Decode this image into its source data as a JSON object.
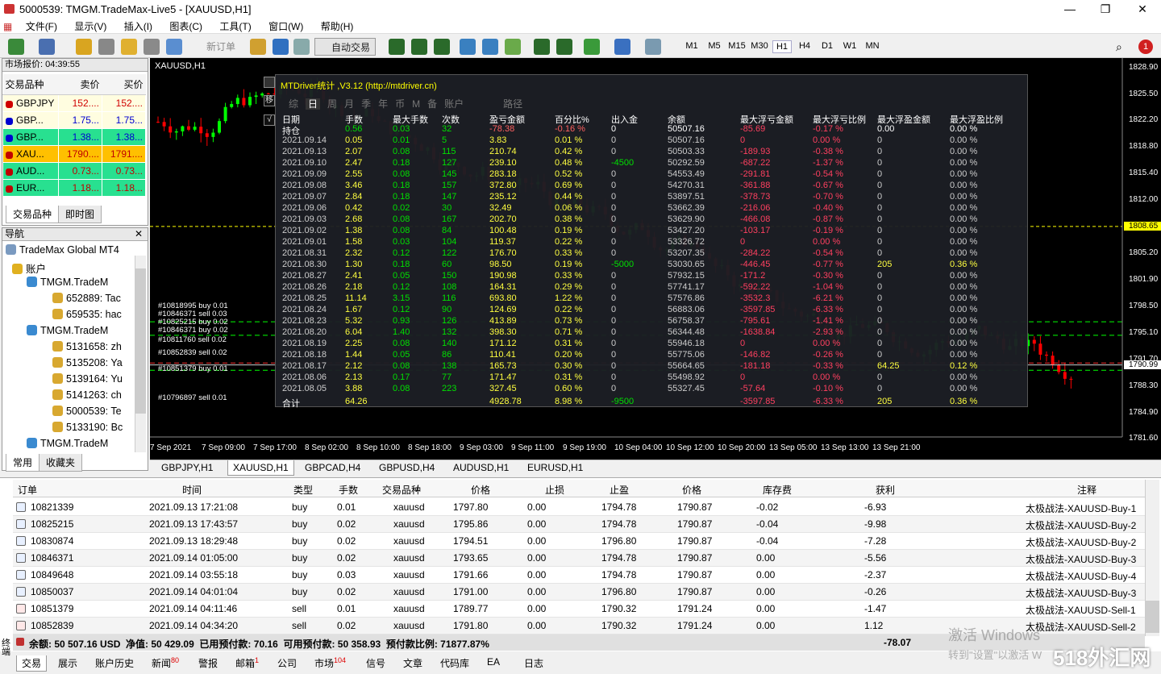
{
  "window": {
    "title": "5000539: TMGM.TradeMax-Live5 - [XAUUSD,H1]"
  },
  "menu": [
    "文件(F)",
    "显示(V)",
    "插入(I)",
    "图表(C)",
    "工具(T)",
    "窗口(W)",
    "帮助(H)"
  ],
  "toolbar": {
    "new_order": "新订单",
    "auto_trade": "自动交易",
    "timeframes": [
      "M1",
      "M5",
      "M15",
      "M30",
      "H1",
      "H4",
      "D1",
      "W1",
      "MN"
    ],
    "active_tf": "H1",
    "notify_count": "1"
  },
  "market_watch": {
    "title": "市场报价: 04:39:55",
    "headers": [
      "交易品种",
      "卖价",
      "买价"
    ],
    "rows": [
      {
        "sym": "GBPJPY",
        "bid": "152....",
        "ask": "152....",
        "bg": "#fffde0",
        "color": "#d00000"
      },
      {
        "sym": "GBP...",
        "bid": "1.75...",
        "ask": "1.75...",
        "bg": "#fffde0",
        "color": "#0000d0"
      },
      {
        "sym": "GBP...",
        "bid": "1.38...",
        "ask": "1.38...",
        "bg": "#28e090",
        "color": "#0000d0"
      },
      {
        "sym": "XAU...",
        "bid": "1790....",
        "ask": "1791....",
        "bg": "#ffc000",
        "color": "#c00000"
      },
      {
        "sym": "AUD...",
        "bid": "0.73...",
        "ask": "0.73...",
        "bg": "#28e090",
        "color": "#c00000"
      },
      {
        "sym": "EUR...",
        "bid": "1.18...",
        "ask": "1.18...",
        "bg": "#28e090",
        "color": "#c00000"
      }
    ],
    "tabs": [
      "交易品种",
      "即时图"
    ]
  },
  "navigator": {
    "title": "导航",
    "items": [
      "TradeMax Global MT4",
      "账户",
      "TMGM.TradeM",
      "652889: Tac",
      "659535: hac",
      "TMGM.TradeM",
      "5131658: zh",
      "5135208: Ya",
      "5139164: Yu",
      "5141263: ch",
      "5000539: Te",
      "5133190: Bc",
      "TMGM.TradeM"
    ],
    "tabs": [
      "常用",
      "收藏夹"
    ]
  },
  "chart": {
    "symbol": "XAUUSD,H1",
    "prices": [
      "1828.90",
      "1825.50",
      "1822.20",
      "1818.80",
      "1815.40",
      "1812.00",
      "1808.65",
      "1805.20",
      "1801.90",
      "1798.50",
      "1795.10",
      "1791.70",
      "1790.99",
      "1788.30",
      "1784.90",
      "1781.60"
    ],
    "times": [
      "7 Sep 2021",
      "7 Sep 09:00",
      "7 Sep 17:00",
      "8 Sep 02:00",
      "8 Sep 10:00",
      "8 Sep 18:00",
      "9 Sep 03:00",
      "9 Sep 11:00",
      "9 Sep 19:00",
      "10 Sep 04:00",
      "10 Sep 12:00",
      "10 Sep 20:00",
      "13 Sep 05:00",
      "13 Sep 13:00",
      "13 Sep 21:00"
    ],
    "orders": [
      "#10818995 buy 0.01",
      "#10846371 sell 0.03",
      "#10825215 buy 0.02",
      "#10846371 buy 0.02",
      "#10811760 sell 0.02",
      "#10852839 sell 0.02",
      "#10851379 buy 0.01",
      "#10796897 sell 0.01"
    ]
  },
  "stat": {
    "title": "MTDriver统计 ,V3.12 (http://mtdriver.cn)",
    "tabs": [
      "综",
      "日",
      "周",
      "月",
      "季",
      "年",
      "币",
      "M",
      "备",
      "账户",
      "路径"
    ],
    "active_tab": "日",
    "side_buttons": [
      "移",
      "√"
    ],
    "headers": [
      "日期",
      "手数",
      "最大手数",
      "次数",
      "盈亏金额",
      "百分比%",
      "出入金",
      "余额",
      "最大浮亏金额",
      "最大浮亏比例",
      "最大浮盈金额",
      "最大浮盈比例"
    ],
    "hold": [
      "持仓",
      "0.56",
      "0.03",
      "32",
      "-78.38",
      "-0.16 %",
      "0",
      "50507.16",
      "-85.69",
      "-0.17 %",
      "0.00",
      "0.00 %"
    ],
    "rows": [
      [
        "2021.09.14",
        "0.05",
        "0.01",
        "5",
        "3.83",
        "0.01 %",
        "0",
        "50507.16",
        "0",
        "0.00 %",
        "0",
        "0.00 %"
      ],
      [
        "2021.09.13",
        "2.07",
        "0.08",
        "115",
        "210.74",
        "0.42 %",
        "0",
        "50503.33",
        "-189.93",
        "-0.38 %",
        "0",
        "0.00 %"
      ],
      [
        "2021.09.10",
        "2.47",
        "0.18",
        "127",
        "239.10",
        "0.48 %",
        "-4500",
        "50292.59",
        "-687.22",
        "-1.37 %",
        "0",
        "0.00 %"
      ],
      [
        "2021.09.09",
        "2.55",
        "0.08",
        "145",
        "283.18",
        "0.52 %",
        "0",
        "54553.49",
        "-291.81",
        "-0.54 %",
        "0",
        "0.00 %"
      ],
      [
        "2021.09.08",
        "3.46",
        "0.18",
        "157",
        "372.80",
        "0.69 %",
        "0",
        "54270.31",
        "-361.88",
        "-0.67 %",
        "0",
        "0.00 %"
      ],
      [
        "2021.09.07",
        "2.84",
        "0.18",
        "147",
        "235.12",
        "0.44 %",
        "0",
        "53897.51",
        "-378.73",
        "-0.70 %",
        "0",
        "0.00 %"
      ],
      [
        "2021.09.06",
        "0.42",
        "0.02",
        "30",
        "32.49",
        "0.06 %",
        "0",
        "53662.39",
        "-216.06",
        "-0.40 %",
        "0",
        "0.00 %"
      ],
      [
        "2021.09.03",
        "2.68",
        "0.08",
        "167",
        "202.70",
        "0.38 %",
        "0",
        "53629.90",
        "-466.08",
        "-0.87 %",
        "0",
        "0.00 %"
      ],
      [
        "2021.09.02",
        "1.38",
        "0.08",
        "84",
        "100.48",
        "0.19 %",
        "0",
        "53427.20",
        "-103.17",
        "-0.19 %",
        "0",
        "0.00 %"
      ],
      [
        "2021.09.01",
        "1.58",
        "0.03",
        "104",
        "119.37",
        "0.22 %",
        "0",
        "53326.72",
        "0",
        "0.00 %",
        "0",
        "0.00 %"
      ],
      [
        "2021.08.31",
        "2.32",
        "0.12",
        "122",
        "176.70",
        "0.33 %",
        "0",
        "53207.35",
        "-284.22",
        "-0.54 %",
        "0",
        "0.00 %"
      ],
      [
        "2021.08.30",
        "1.30",
        "0.18",
        "60",
        "98.50",
        "0.19 %",
        "-5000",
        "53030.65",
        "-446.45",
        "-0.77 %",
        "205",
        "0.36 %"
      ],
      [
        "2021.08.27",
        "2.41",
        "0.05",
        "150",
        "190.98",
        "0.33 %",
        "0",
        "57932.15",
        "-171.2",
        "-0.30 %",
        "0",
        "0.00 %"
      ],
      [
        "2021.08.26",
        "2.18",
        "0.12",
        "108",
        "164.31",
        "0.29 %",
        "0",
        "57741.17",
        "-592.22",
        "-1.04 %",
        "0",
        "0.00 %"
      ],
      [
        "2021.08.25",
        "11.14",
        "3.15",
        "116",
        "693.80",
        "1.22 %",
        "0",
        "57576.86",
        "-3532.3",
        "-6.21 %",
        "0",
        "0.00 %"
      ],
      [
        "2021.08.24",
        "1.67",
        "0.12",
        "90",
        "124.69",
        "0.22 %",
        "0",
        "56883.06",
        "-3597.85",
        "-6.33 %",
        "0",
        "0.00 %"
      ],
      [
        "2021.08.23",
        "5.32",
        "0.93",
        "126",
        "413.89",
        "0.73 %",
        "0",
        "56758.37",
        "-795.61",
        "-1.41 %",
        "0",
        "0.00 %"
      ],
      [
        "2021.08.20",
        "6.04",
        "1.40",
        "132",
        "398.30",
        "0.71 %",
        "0",
        "56344.48",
        "-1638.84",
        "-2.93 %",
        "0",
        "0.00 %"
      ],
      [
        "2021.08.19",
        "2.25",
        "0.08",
        "140",
        "171.12",
        "0.31 %",
        "0",
        "55946.18",
        "0",
        "0.00 %",
        "0",
        "0.00 %"
      ],
      [
        "2021.08.18",
        "1.44",
        "0.05",
        "86",
        "110.41",
        "0.20 %",
        "0",
        "55775.06",
        "-146.82",
        "-0.26 %",
        "0",
        "0.00 %"
      ],
      [
        "2021.08.17",
        "2.12",
        "0.08",
        "138",
        "165.73",
        "0.30 %",
        "0",
        "55664.65",
        "-181.18",
        "-0.33 %",
        "64.25",
        "0.12 %"
      ],
      [
        "2021.08.06",
        "2.13",
        "0.17",
        "77",
        "171.47",
        "0.31 %",
        "0",
        "55498.92",
        "0",
        "0.00 %",
        "0",
        "0.00 %"
      ],
      [
        "2021.08.05",
        "3.88",
        "0.08",
        "223",
        "327.45",
        "0.60 %",
        "0",
        "55327.45",
        "-57.64",
        "-0.10 %",
        "0",
        "0.00 %"
      ]
    ],
    "total": [
      "合计",
      "64.26",
      "",
      "",
      "4928.78",
      "8.98 %",
      "-9500",
      "",
      "-3597.85",
      "-6.33 %",
      "205",
      "0.36 %"
    ]
  },
  "chart_tabs": [
    "GBPJPY,H1",
    "XAUUSD,H1",
    "GBPCAD,H4",
    "GBPUSD,H4",
    "AUDUSD,H1",
    "EURUSD,H1"
  ],
  "active_chart_tab": "XAUUSD,H1",
  "terminal": {
    "headers": [
      "订单",
      "时间",
      "类型",
      "手数",
      "交易品种",
      "/",
      "价格",
      "止损",
      "止盈",
      "价格",
      "库存费",
      "获利",
      "注释"
    ],
    "rows": [
      [
        "10821339",
        "2021.09.13 17:21:08",
        "buy",
        "0.01",
        "xauusd",
        "1797.80",
        "0.00",
        "1794.78",
        "1790.87",
        "-0.02",
        "-6.93",
        "太极战法-XAUUSD-Buy-1"
      ],
      [
        "10825215",
        "2021.09.13 17:43:57",
        "buy",
        "0.02",
        "xauusd",
        "1795.86",
        "0.00",
        "1794.78",
        "1790.87",
        "-0.04",
        "-9.98",
        "太极战法-XAUUSD-Buy-2"
      ],
      [
        "10830874",
        "2021.09.13 18:29:48",
        "buy",
        "0.02",
        "xauusd",
        "1794.51",
        "0.00",
        "1796.80",
        "1790.87",
        "-0.04",
        "-7.28",
        "太极战法-XAUUSD-Buy-2"
      ],
      [
        "10846371",
        "2021.09.14 01:05:00",
        "buy",
        "0.02",
        "xauusd",
        "1793.65",
        "0.00",
        "1794.78",
        "1790.87",
        "0.00",
        "-5.56",
        "太极战法-XAUUSD-Buy-3"
      ],
      [
        "10849648",
        "2021.09.14 03:55:18",
        "buy",
        "0.03",
        "xauusd",
        "1791.66",
        "0.00",
        "1794.78",
        "1790.87",
        "0.00",
        "-2.37",
        "太极战法-XAUUSD-Buy-4"
      ],
      [
        "10850037",
        "2021.09.14 04:01:04",
        "buy",
        "0.02",
        "xauusd",
        "1791.00",
        "0.00",
        "1796.80",
        "1790.87",
        "0.00",
        "-0.26",
        "太极战法-XAUUSD-Buy-3"
      ],
      [
        "10851379",
        "2021.09.14 04:11:46",
        "sell",
        "0.01",
        "xauusd",
        "1789.77",
        "0.00",
        "1790.32",
        "1791.24",
        "0.00",
        "-1.47",
        "太极战法-XAUUSD-Sell-1"
      ],
      [
        "10852839",
        "2021.09.14 04:34:20",
        "sell",
        "0.02",
        "xauusd",
        "1791.80",
        "0.00",
        "1790.32",
        "1791.24",
        "0.00",
        "1.12",
        "太极战法-XAUUSD-Sell-2"
      ]
    ],
    "balance": "余额: 50 507.16 USD  净值: 50 429.09  已用预付款: 70.16  可用预付款: 50 358.93  预付款比例: 71877.87%",
    "total_profit": "-78.07",
    "side_label": "终端",
    "tabs": [
      {
        "label": "交易",
        "badge": ""
      },
      {
        "label": "展示",
        "badge": ""
      },
      {
        "label": "账户历史",
        "badge": ""
      },
      {
        "label": "新闻",
        "badge": "80"
      },
      {
        "label": "警报",
        "badge": ""
      },
      {
        "label": "邮箱",
        "badge": "1"
      },
      {
        "label": "公司",
        "badge": ""
      },
      {
        "label": "市场",
        "badge": "104"
      },
      {
        "label": "信号",
        "badge": ""
      },
      {
        "label": "文章",
        "badge": ""
      },
      {
        "label": "代码库",
        "badge": ""
      },
      {
        "label": "EA",
        "badge": ""
      },
      {
        "label": "日志",
        "badge": ""
      }
    ]
  },
  "watermark": {
    "line1": "激活 Windows",
    "line2": "转到\"设置\"以激活 W",
    "brand": "518外汇网"
  }
}
